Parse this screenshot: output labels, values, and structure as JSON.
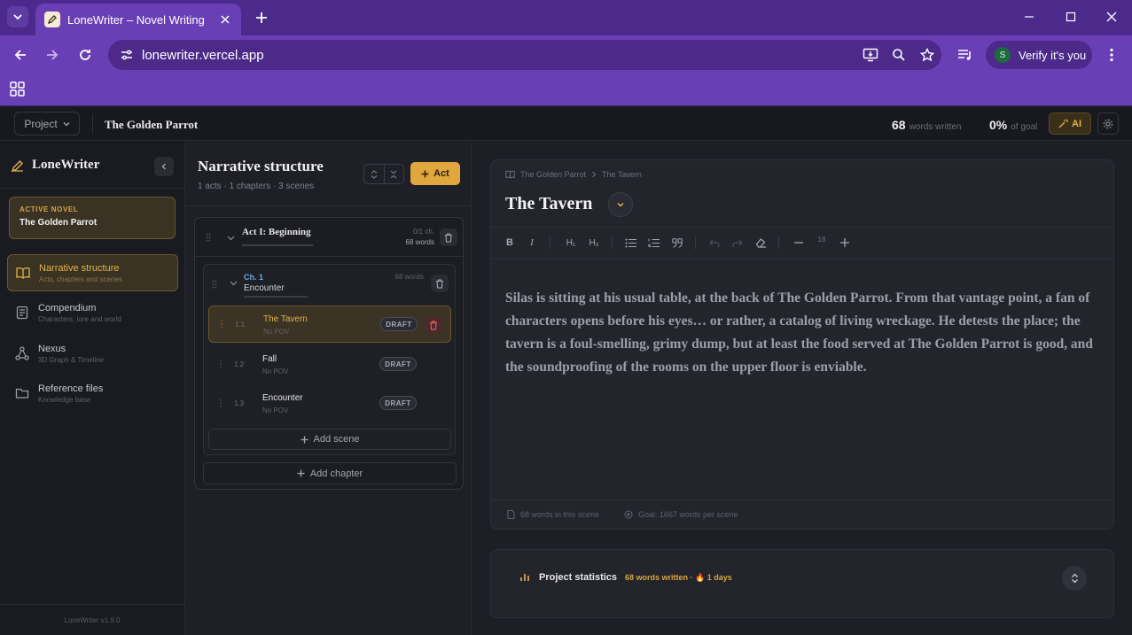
{
  "browser": {
    "tab_title": "LoneWriter – Novel Writing",
    "url": "lonewriter.vercel.app",
    "profile_initial": "S",
    "profile_label": "Verify it's you"
  },
  "appbar": {
    "project_label": "Project",
    "novel_name": "The Golden Parrot",
    "words_count": "68",
    "words_label": "words written",
    "goal_percent": "0%",
    "goal_label": "of goal",
    "ai_label": "AI"
  },
  "sidebar": {
    "logo": "LoneWriter",
    "active_novel_label": "ACTIVE NOVEL",
    "active_novel_name": "The Golden Parrot",
    "items": [
      {
        "title": "Narrative structure",
        "subtitle": "Acts, chapters and scenes"
      },
      {
        "title": "Compendium",
        "subtitle": "Characters, lore and world"
      },
      {
        "title": "Nexus",
        "subtitle": "3D Graph & Timeline"
      },
      {
        "title": "Reference files",
        "subtitle": "Knowledge base"
      }
    ],
    "version": "LoneWriter v1.9.0"
  },
  "structure": {
    "title": "Narrative structure",
    "summary": "1 acts · 1 chapters · 3 scenes",
    "add_act_label": "Act",
    "act": {
      "name": "Act I: Beginning",
      "chapters_meta": "0/1 ch.",
      "words_meta": "68 words"
    },
    "chapter": {
      "number": "Ch. 1",
      "name": "Encounter",
      "words": "68 words"
    },
    "scenes": [
      {
        "num": "1.1",
        "title": "The Tavern",
        "pov": "No POV",
        "status": "DRAFT"
      },
      {
        "num": "1.2",
        "title": "Fall",
        "pov": "No POV",
        "status": "DRAFT"
      },
      {
        "num": "1.3",
        "title": "Encounter",
        "pov": "No POV",
        "status": "DRAFT"
      }
    ],
    "add_scene_label": "Add scene",
    "add_chapter_label": "Add chapter"
  },
  "editor": {
    "breadcrumb_novel": "The Golden Parrot",
    "breadcrumb_scene": "The Tavern",
    "title": "The Tavern",
    "toolbar": {
      "bold": "B",
      "italic": "I",
      "h1": "H₁",
      "h2": "H₂",
      "font_size": "18"
    },
    "content": "Silas is sitting at his usual table, at the back of The Golden Parrot. From that vantage point, a fan of characters opens before his eyes… or rather, a catalog of living wreckage. He detests the place; the tavern is a foul-smelling, grimy dump, but at least the food served at The Golden Parrot is good, and the soundproofing of the rooms on the upper floor is enviable.",
    "scene_words": "68 words in this scene",
    "goal_text": "Goal: 1667 words per scene"
  },
  "stats": {
    "title": "Project statistics",
    "meta": "68 words written · 🔥 1 days"
  },
  "colors": {
    "accent": "#e1a73f",
    "chrome": "#6a3fb5",
    "chapter_blue": "#6aa8e8",
    "delete_red": "#e05a5a"
  }
}
